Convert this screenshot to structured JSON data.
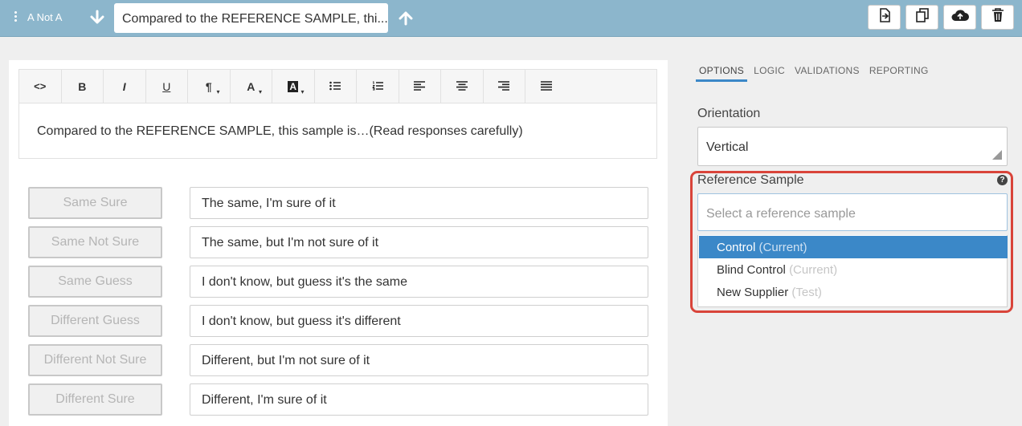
{
  "topbar": {
    "question_name": "A Not A",
    "question_title": "Compared to the REFERENCE SAMPLE, thi...",
    "icons": [
      "drag-handle-icon",
      "arrow-down-icon",
      "arrow-up-icon",
      "preview-icon",
      "duplicate-icon",
      "cloud-upload-icon",
      "trash-icon"
    ]
  },
  "toolbar": {
    "buttons": [
      {
        "label": "<>",
        "name": "code-view"
      },
      {
        "label": "B",
        "name": "bold"
      },
      {
        "label": "I",
        "name": "italic"
      },
      {
        "label": "U",
        "name": "underline"
      },
      {
        "label": "¶",
        "name": "paragraph"
      },
      {
        "label": "A",
        "name": "font-color"
      },
      {
        "label": "A",
        "name": "background-color"
      },
      {
        "label": "",
        "name": "bullet-list"
      },
      {
        "label": "",
        "name": "numbered-list"
      },
      {
        "label": "",
        "name": "align-left"
      },
      {
        "label": "",
        "name": "align-center"
      },
      {
        "label": "",
        "name": "align-right"
      },
      {
        "label": "",
        "name": "justify"
      }
    ]
  },
  "editor": {
    "text": "Compared to the REFERENCE SAMPLE, this sample is…(Read responses carefully)"
  },
  "responses": [
    {
      "code": "Same Sure",
      "text": "The same, I'm sure of it"
    },
    {
      "code": "Same Not Sure",
      "text": "The same, but I'm not sure of it"
    },
    {
      "code": "Same Guess",
      "text": "I don't know, but guess it's the same"
    },
    {
      "code": "Different Guess",
      "text": "I don't know, but guess it's different"
    },
    {
      "code": "Different Not Sure",
      "text": "Different, but I'm not sure of it"
    },
    {
      "code": "Different Sure",
      "text": "Different, I'm sure of it"
    }
  ],
  "sidebar": {
    "tabs": [
      {
        "label": "OPTIONS",
        "active": true
      },
      {
        "label": "LOGIC",
        "active": false
      },
      {
        "label": "VALIDATIONS",
        "active": false
      },
      {
        "label": "REPORTING",
        "active": false
      }
    ],
    "orientation_label": "Orientation",
    "orientation_value": "Vertical",
    "reference_label": "Reference Sample",
    "reference_help": "?",
    "reference_placeholder": "Select a reference sample",
    "reference_options": [
      {
        "name": "Control",
        "tag": "(Current)",
        "selected": true
      },
      {
        "name": "Blind Control",
        "tag": "(Current)",
        "selected": false
      },
      {
        "name": "New Supplier",
        "tag": "(Test)",
        "selected": false
      }
    ]
  },
  "colors": {
    "topbar": "#8cb6cc",
    "accent": "#3b88c8",
    "highlight": "#d9443a"
  }
}
